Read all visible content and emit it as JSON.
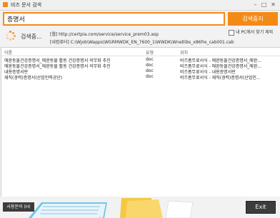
{
  "window": {
    "title": "비즈 문서 검색",
    "min": "–",
    "max": "□",
    "close": "✕"
  },
  "search": {
    "value": "증명서",
    "stop_label": "검색중지"
  },
  "status": {
    "text": "검색중...",
    "url_line": "[웹] http://certpia.com/service/service_prem03.asp",
    "path_line": "[내컴퓨터] C:\\Wjob\\Wapps\\WGRMWDK_EN_7600_1\\WWDK\\Wnetlibs_x86fre_cab001.cab",
    "pc_option_label": "내 PC에서 찾기 제외"
  },
  "results": {
    "headers": {
      "name": "이름",
      "type": "유형",
      "location": "위치"
    },
    "rows": [
      {
        "name": "애완동물건강증명서_애완동물 활동 건강증명서 의무화 추진",
        "type": "doc",
        "location": "비즈폼무료서식 - 애완동물건강증명서_애완..."
      },
      {
        "name": "애완동물건강증명서_애완동물 활동 건강증명서 의무화 추진",
        "type": "doc",
        "location": "비즈폼무료서식 - 애완동물건강증명서_애완..."
      },
      {
        "name": "내용증명서란",
        "type": "doc",
        "location": "비즈폼무료서식 - 내용증명서란"
      },
      {
        "name": "재직(경력)증명서(산업인력공단)",
        "type": "doc",
        "location": "비즈폼무료서식 - 재직(경력)증명서(산업인..."
      }
    ]
  },
  "footer": {
    "help_label": "사용문의 (H)",
    "exit_label": "Exit"
  },
  "colors": {
    "accent": "#f38a18",
    "dark_button": "#3c3c3c"
  }
}
